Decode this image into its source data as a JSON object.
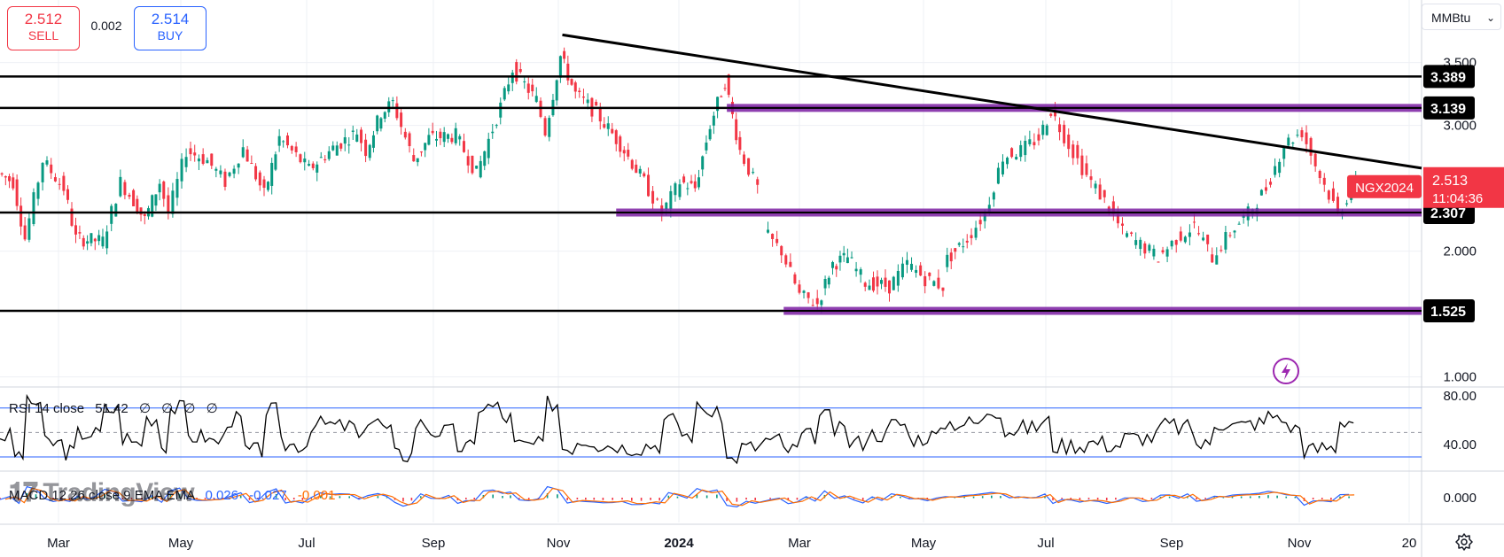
{
  "ticker": {
    "sell_price": "2.512",
    "sell_label": "SELL",
    "spread": "0.002",
    "buy_price": "2.514",
    "buy_label": "BUY"
  },
  "unit_selector": {
    "value": "MMBtu"
  },
  "colors": {
    "up": "#089981",
    "down": "#f23645",
    "line": "#000000",
    "zone": "#7b1fa2",
    "rsi_band": "#2962ff",
    "macd": "#2962ff",
    "signal": "#ff6d00",
    "price_tag": "#f23645"
  },
  "indicators": {
    "rsi": {
      "name": "RSI 14 close",
      "value": "51.42",
      "nav": "∅ ∅ ∅ ∅"
    },
    "macd": {
      "name": "MACD 12 26 close 9 EMA EMA",
      "v1": "0.026",
      "v2": "-0.027",
      "v3": "-0.001"
    }
  },
  "watermark": "TradingView",
  "chart_data": {
    "type": "candlestick",
    "symbol": "NGX2024",
    "last_price": "2.513",
    "countdown": "11:04:36",
    "price_axis": {
      "ticks": [
        "3.500",
        "3.000",
        "2.000",
        "1.000"
      ],
      "tick_values": [
        3.5,
        3.0,
        2.0,
        1.0
      ]
    },
    "horizontal_levels": [
      {
        "value": 3.389,
        "label": "3.389"
      },
      {
        "value": 3.139,
        "label": "3.139"
      },
      {
        "value": 2.307,
        "label": "2.307"
      },
      {
        "value": 1.525,
        "label": "1.525"
      }
    ],
    "x_axis_labels": [
      "Mar",
      "May",
      "Jul",
      "Sep",
      "Nov",
      "2024",
      "Mar",
      "May",
      "Jul",
      "Sep",
      "Nov",
      "20"
    ],
    "rsi_axis": {
      "ticks": [
        "80.00",
        "40.00"
      ],
      "tick_values": [
        80,
        40
      ],
      "bands": [
        70,
        30
      ]
    },
    "macd_axis": {
      "ticks": [
        "0.000"
      ],
      "tick_values": [
        0
      ]
    },
    "series_ranges": [
      {
        "points": [
          [
            0,
            2.62
          ],
          [
            0.025,
            2.55
          ],
          [
            0.045,
            2.1
          ],
          [
            0.075,
            2.72
          ],
          [
            0.11,
            2.5
          ],
          [
            0.13,
            2.1
          ],
          [
            0.175,
            2.08
          ],
          [
            0.205,
            2.55
          ],
          [
            0.22,
            2.45
          ],
          [
            0.245,
            2.25
          ],
          [
            0.27,
            2.55
          ],
          [
            0.285,
            2.3
          ],
          [
            0.315,
            2.8
          ],
          [
            0.35,
            2.72
          ],
          [
            0.38,
            2.55
          ],
          [
            0.41,
            2.82
          ],
          [
            0.445,
            2.45
          ],
          [
            0.47,
            2.9
          ],
          [
            0.52,
            2.65
          ],
          [
            0.56,
            2.82
          ],
          [
            0.6,
            2.95
          ],
          [
            0.615,
            2.8
          ],
          [
            0.64,
            3.1
          ],
          [
            0.66,
            3.18
          ],
          [
            0.695,
            2.72
          ],
          [
            0.72,
            2.9
          ],
          [
            0.765,
            2.92
          ],
          [
            0.8,
            2.62
          ]
        ]
      },
      {
        "points": [
          [
            0.8,
            2.62
          ],
          [
            0.84,
            3.15
          ],
          [
            0.86,
            3.45
          ],
          [
            0.9,
            3.2
          ],
          [
            0.915,
            2.95
          ],
          [
            0.94,
            3.55
          ],
          [
            0.965,
            3.25
          ],
          [
            1.0,
            3.1
          ],
          [
            1.04,
            2.85
          ],
          [
            1.08,
            2.55
          ],
          [
            1.11,
            2.3
          ],
          [
            1.14,
            2.55
          ],
          [
            1.165,
            2.5
          ],
          [
            1.19,
            3.0
          ],
          [
            1.215,
            3.35
          ],
          [
            1.24,
            2.8
          ],
          [
            1.27,
            2.5
          ]
        ]
      },
      {
        "points": [
          [
            1.28,
            2.15
          ],
          [
            1.31,
            2.0
          ],
          [
            1.34,
            1.65
          ],
          [
            1.37,
            1.58
          ],
          [
            1.395,
            1.9
          ],
          [
            1.42,
            1.95
          ],
          [
            1.45,
            1.75
          ],
          [
            1.49,
            1.72
          ],
          [
            1.52,
            1.9
          ],
          [
            1.55,
            1.78
          ],
          [
            1.58,
            1.72
          ]
        ]
      },
      {
        "points": [
          [
            1.58,
            1.9
          ],
          [
            1.62,
            2.1
          ],
          [
            1.65,
            2.3
          ],
          [
            1.68,
            2.75
          ],
          [
            1.71,
            2.8
          ],
          [
            1.74,
            2.9
          ],
          [
            1.76,
            3.12
          ],
          [
            1.79,
            2.85
          ],
          [
            1.82,
            2.6
          ],
          [
            1.85,
            2.4
          ],
          [
            1.88,
            2.15
          ],
          [
            1.91,
            2.05
          ],
          [
            1.94,
            1.95
          ],
          [
            1.97,
            2.1
          ],
          [
            2.0,
            2.2
          ],
          [
            2.03,
            1.95
          ],
          [
            2.06,
            2.15
          ],
          [
            2.09,
            2.3
          ],
          [
            2.12,
            2.5
          ],
          [
            2.15,
            2.85
          ],
          [
            2.18,
            2.95
          ],
          [
            2.21,
            2.6
          ],
          [
            2.24,
            2.3
          ],
          [
            2.27,
            2.55
          ]
        ]
      }
    ],
    "resistance_trendline": {
      "from": [
        0.94,
        3.72
      ],
      "to": [
        2.47,
        2.66
      ]
    },
    "zones": [
      {
        "from": 1.215,
        "to": 2.47,
        "value": 3.139
      },
      {
        "from": 1.03,
        "to": 2.47,
        "value": 2.307
      },
      {
        "from": 1.31,
        "to": 2.47,
        "value": 1.525
      }
    ]
  }
}
